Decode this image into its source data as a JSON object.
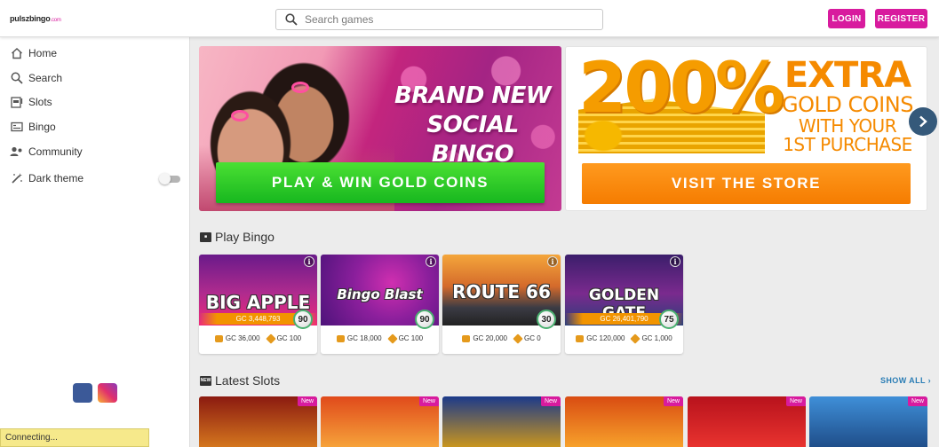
{
  "header": {
    "logo_name": "pulszbingo",
    "logo_suffix": ".com",
    "search_placeholder": "Search games",
    "login_label": "LOGIN",
    "register_label": "REGISTER",
    "brand_color": "#d81b9e"
  },
  "sidebar": {
    "items": [
      {
        "label": "Home",
        "icon": "home-icon"
      },
      {
        "label": "Search",
        "icon": "search-icon"
      },
      {
        "label": "Slots",
        "icon": "slot-machine-icon"
      },
      {
        "label": "Bingo",
        "icon": "bingo-card-icon"
      },
      {
        "label": "Community",
        "icon": "community-icon"
      },
      {
        "label": "Dark theme",
        "icon": "magic-wand-icon"
      }
    ],
    "dark_theme_enabled": false,
    "social": [
      "facebook-icon",
      "instagram-icon"
    ]
  },
  "status": {
    "text": "Connecting..."
  },
  "banners": [
    {
      "headline_line1": "BRAND NEW",
      "headline_line2": "SOCIAL BINGO",
      "cta": "PLAY & WIN GOLD COINS",
      "cta_color": "#1fbf24"
    },
    {
      "big_text": "200%",
      "line1": "EXTRA",
      "line2": "GOLD COINS",
      "line3": "WITH YOUR",
      "line4": "1ST PURCHASE",
      "cta": "VISIT THE STORE",
      "cta_color": "#f58400"
    }
  ],
  "play_bingo": {
    "title": "Play Bingo",
    "cards": [
      {
        "title": "BIG APPLE",
        "jackpot": "GC 3,448,793",
        "ball": "90",
        "gc": "GC 36,000",
        "price": "GC 100"
      },
      {
        "title": "Bingo Blast",
        "jackpot": "",
        "ball": "90",
        "gc": "GC 18,000",
        "price": "GC 100"
      },
      {
        "title": "ROUTE 66",
        "jackpot": "",
        "ball": "30",
        "gc": "GC 20,000",
        "price": "GC 0"
      },
      {
        "title": "GOLDEN GATE",
        "jackpot": "GC 26,401,790",
        "ball": "75",
        "gc": "GC 120,000",
        "price": "GC 1,000"
      }
    ]
  },
  "latest_slots": {
    "title": "Latest Slots",
    "show_all": "SHOW ALL",
    "badge": "New",
    "count": 6
  }
}
